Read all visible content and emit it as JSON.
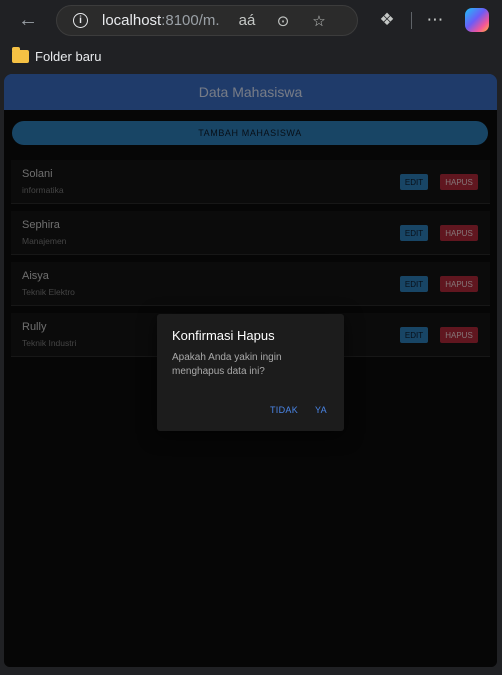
{
  "browser": {
    "url_host": "localhost",
    "url_rest": ":8100/m...",
    "bookmark_folder": "Folder baru",
    "icons": [
      "back-arrow-icon",
      "info-icon",
      "read-aloud-icon",
      "zoom-icon",
      "favorite-star-icon",
      "extensions-icon",
      "more-icon",
      "copilot-icon"
    ]
  },
  "app": {
    "title": "Data Mahasiswa",
    "add_button": "TAMBAH MAHASISWA",
    "students": [
      {
        "name": "Solani",
        "major": "informatika"
      },
      {
        "name": "Sephira",
        "major": "Manajemen"
      },
      {
        "name": "Aisya",
        "major": "Teknik Elektro"
      },
      {
        "name": "Rully",
        "major": "Teknik Industri"
      }
    ],
    "edit_label": "EDIT",
    "delete_label": "HAPUS"
  },
  "dialog": {
    "title": "Konfirmasi Hapus",
    "message": "Apakah Anda yakin ingin menghapus data ini?",
    "cancel": "TIDAK",
    "confirm": "YA"
  },
  "colors": {
    "header": "#3a6cc2",
    "primary_button": "#2d7fb8",
    "danger_button": "#b0283a",
    "dialog_accent": "#4a86e8"
  }
}
